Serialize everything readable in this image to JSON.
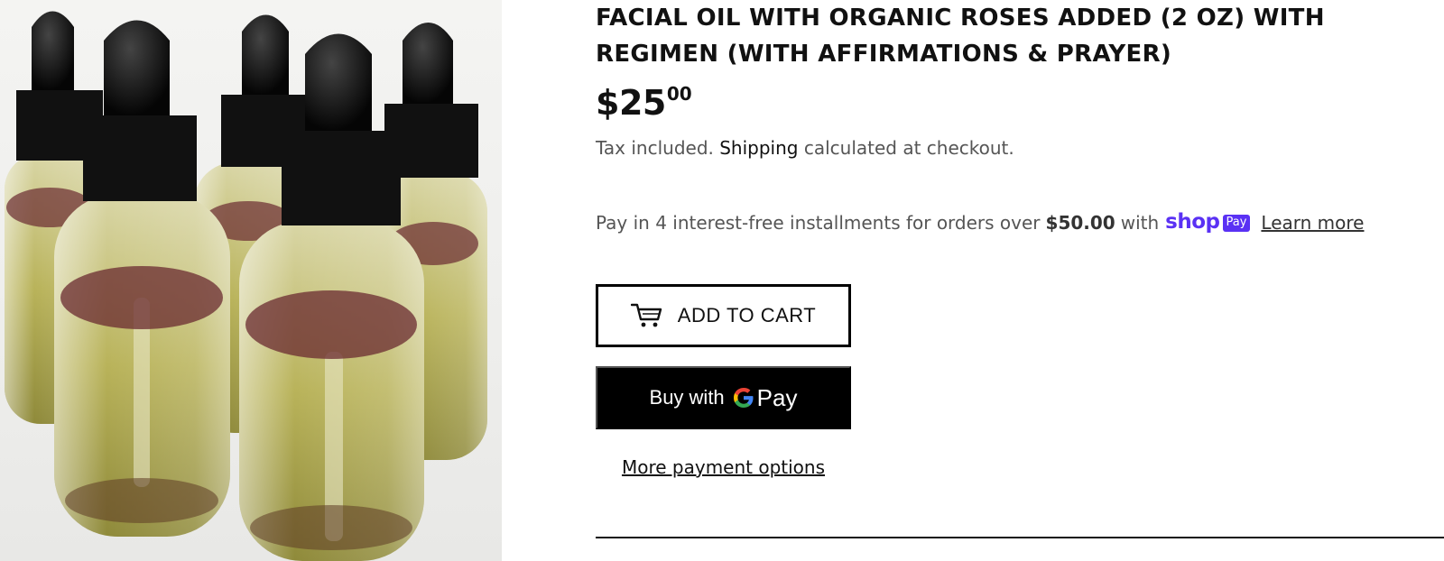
{
  "product": {
    "title": "FACIAL OIL WITH ORGANIC ROSES ADDED (2 OZ) WITH REGIMEN (WITH AFFIRMATIONS & PRAYER)",
    "price_main": "$25",
    "price_cents": "00",
    "image_alt": "Five glass dropper bottles of facial oil with dried rose petals"
  },
  "tax": {
    "prefix": "Tax included.",
    "shipping_link": "Shipping",
    "suffix": "calculated at checkout."
  },
  "installments": {
    "text": "Pay in 4 interest-free installments for orders over",
    "amount": "$50.00",
    "with": "with",
    "shop_word": "shop",
    "pay_badge": "Pay",
    "learn_more": "Learn more"
  },
  "actions": {
    "add_to_cart": "ADD TO CART",
    "buy_with": "Buy with",
    "gpay_text": "Pay",
    "more_options": "More payment options"
  },
  "colors": {
    "shop_purple": "#5a31f4",
    "button_black": "#000000",
    "text_gray": "#555555"
  },
  "icons": {
    "cart": "cart-icon",
    "google": "google-g-icon"
  }
}
